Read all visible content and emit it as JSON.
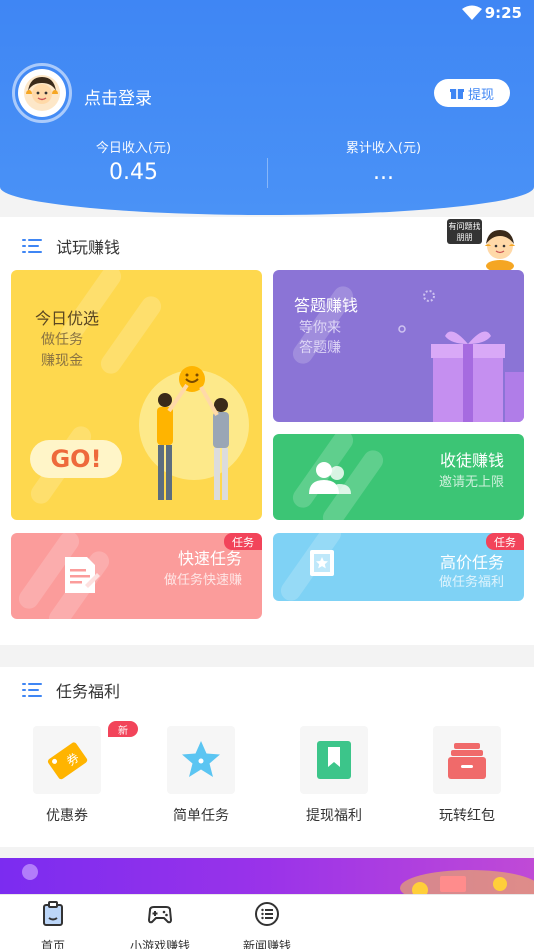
{
  "status_bar": {
    "time": "9:25"
  },
  "user": {
    "login_label": "点击登录",
    "withdraw_label": "提现"
  },
  "income": {
    "today_label": "今日收入(元)",
    "today_value": "0.45",
    "total_label": "累计收入(元)",
    "total_value": "..."
  },
  "trial_section": {
    "title": "试玩赚钱",
    "help_text": "有问题找朋朋",
    "cards": {
      "featured": {
        "title": "今日优选",
        "line1": "做任务",
        "line2": "赚现金",
        "go_label": "GO!"
      },
      "quiz": {
        "title": "答题赚钱",
        "line1": "等你来",
        "line2": "答题赚"
      },
      "invite": {
        "title": "收徒赚钱",
        "subtitle": "邀请无上限"
      },
      "quick": {
        "title": "快速任务",
        "subtitle": "做任务快速赚",
        "badge": "任务"
      },
      "premium": {
        "title": "高价任务",
        "subtitle": "做任务福利",
        "badge": "任务"
      }
    }
  },
  "welfare_section": {
    "title": "任务福利",
    "new_badge": "新",
    "items": [
      {
        "label": "优惠券",
        "icon": "coupon-icon"
      },
      {
        "label": "简单任务",
        "icon": "star-icon"
      },
      {
        "label": "提现福利",
        "icon": "bookmark-icon"
      },
      {
        "label": "玩转红包",
        "icon": "red-packet-icon"
      }
    ]
  },
  "bottom_nav": [
    {
      "label": "首页",
      "icon": "home-icon"
    },
    {
      "label": "小游戏赚钱",
      "icon": "gamepad-icon"
    },
    {
      "label": "新闻赚钱",
      "icon": "news-icon"
    }
  ],
  "colors": {
    "header_blue": "#3f86f4",
    "featured_yellow": "#fed84e",
    "quiz_purple": "#8b74d6",
    "invite_green": "#3cc575",
    "quick_pink": "#fb9c9b",
    "premium_blue": "#7fd2f5",
    "badge_red": "#f2445a"
  }
}
